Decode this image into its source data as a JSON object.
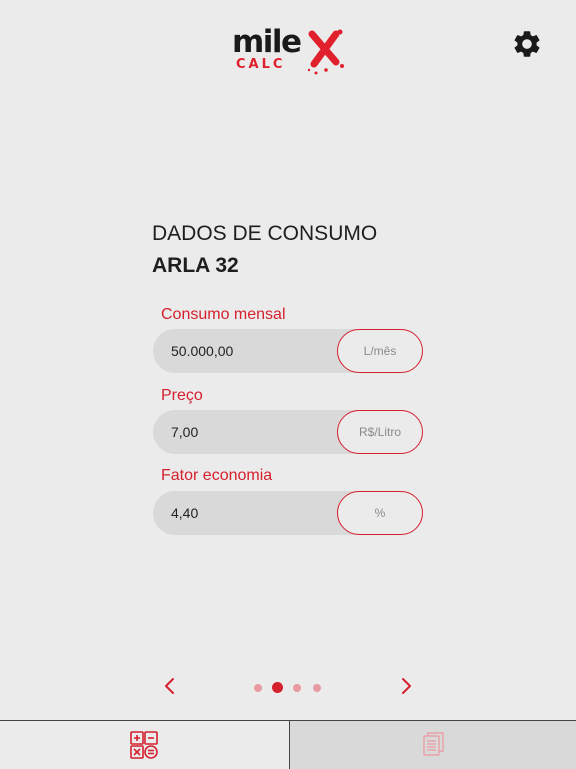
{
  "header": {
    "logo_main": "mile",
    "logo_sub": "CALC",
    "settings_icon": "gear-icon"
  },
  "section": {
    "label": "DADOS DE CONSUMO",
    "title": "ARLA 32"
  },
  "fields": [
    {
      "label": "Consumo mensal",
      "value": "50.000,00",
      "unit": "L/mês"
    },
    {
      "label": "Preço",
      "value": "7,00",
      "unit": "R$/Litro"
    },
    {
      "label": "Fator economia",
      "value": "4,40",
      "unit": "%"
    }
  ],
  "pager": {
    "prev_icon": "chevron-left-icon",
    "next_icon": "chevron-right-icon",
    "page_count": 4,
    "active_page": 2
  },
  "tabbar": {
    "tabs": [
      {
        "icon": "calculator-icon",
        "selected": true
      },
      {
        "icon": "report-documents-icon",
        "selected": false
      }
    ]
  },
  "colors": {
    "accent": "#d5202d",
    "background": "#ebebeb",
    "field": "#d9d9d9",
    "text": "#1e1e1e"
  }
}
